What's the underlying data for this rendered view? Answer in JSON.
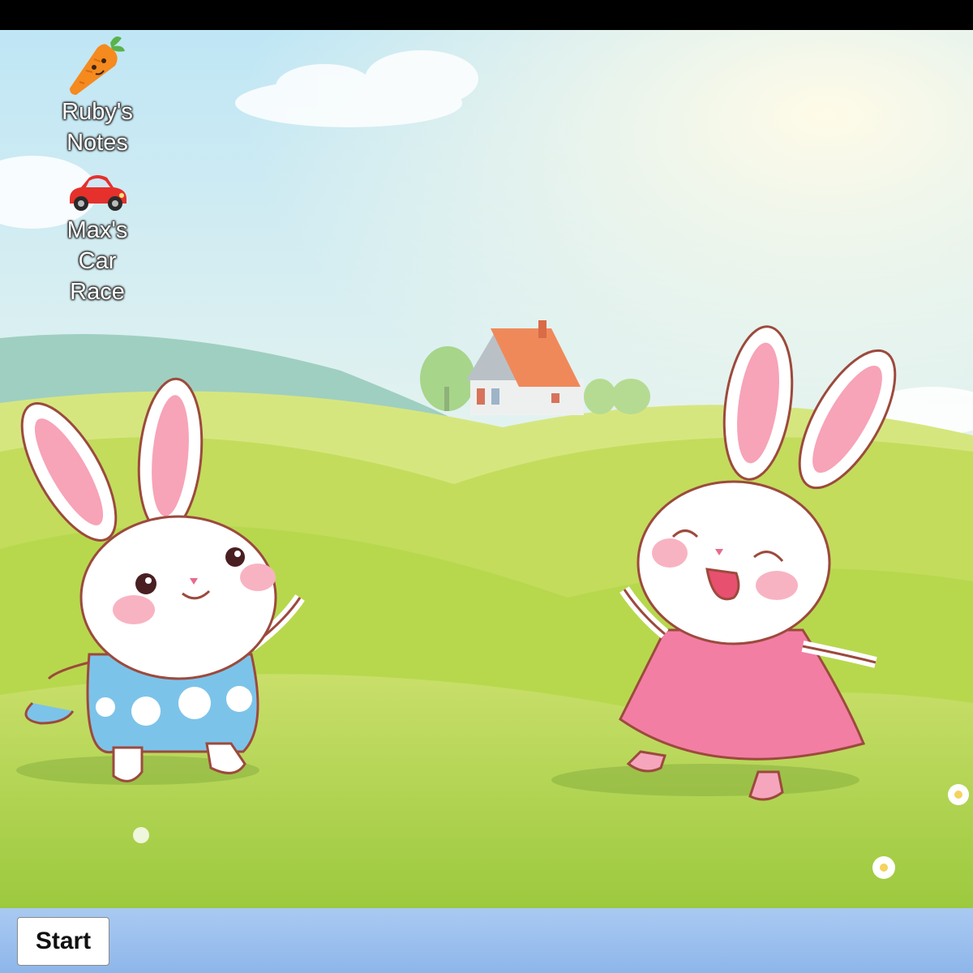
{
  "desktop": {
    "icons": [
      {
        "label": "Ruby's Notes",
        "icon": "carrot-icon"
      },
      {
        "label": "Max's Car Race",
        "icon": "red-car-icon"
      }
    ],
    "wallpaper": "bunnies-meadow-wallpaper"
  },
  "taskbar": {
    "start_label": "Start"
  },
  "colors": {
    "sky": "#cfe9f6",
    "grass": "#b9d95a",
    "taskbar": "#9dc1ef",
    "dress_pink": "#f27ea4",
    "dress_blue": "#7cc3ea"
  }
}
